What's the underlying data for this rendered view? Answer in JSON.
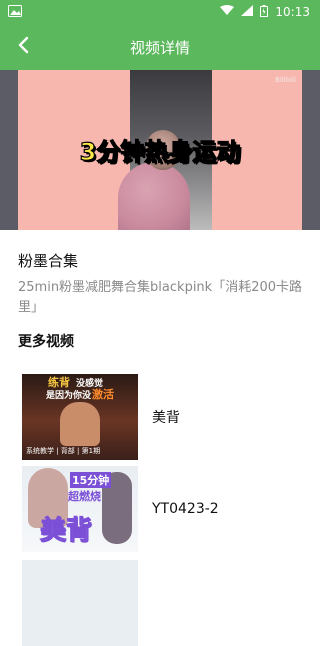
{
  "status": {
    "time": "10:13"
  },
  "appbar": {
    "title": "视频详情"
  },
  "video": {
    "overlay_text": "3分钟热身运动",
    "watermark": "Bilibili"
  },
  "collection": {
    "title": "粉墨合集",
    "description": "25min粉墨减肥舞合集blackpink「消耗200卡路里」"
  },
  "more": {
    "title": "更多视频",
    "items": [
      {
        "label": "美背",
        "thumb_text_1": "练背",
        "thumb_text_2": "没感觉",
        "thumb_text_3": "是因为你没",
        "thumb_text_4": "激活",
        "thumb_footer": "系统教学 | 背部 | 第1期"
      },
      {
        "label": "YT0423-2",
        "thumb_text_1": "15分钟",
        "thumb_text_2": "超燃烧",
        "thumb_text_3": "美背"
      },
      {
        "label": ""
      }
    ]
  },
  "colors": {
    "primary": "#5cb85c"
  }
}
